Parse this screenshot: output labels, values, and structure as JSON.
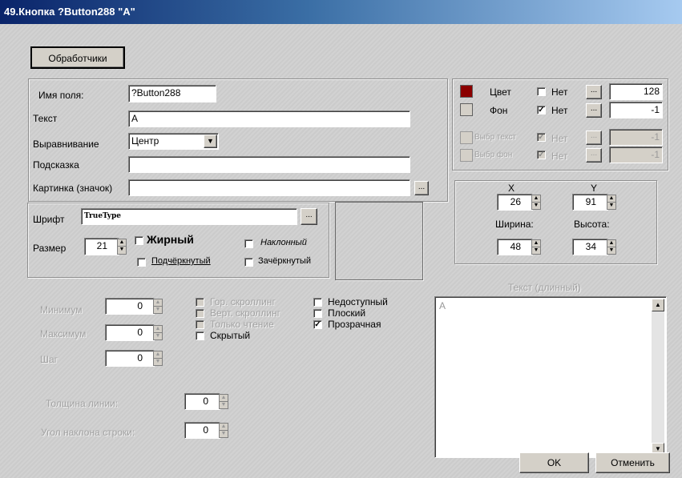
{
  "window": {
    "title": "49.Кнопка ?Button288 \"A\""
  },
  "toolbar": {
    "handlers_label": "Обработчики"
  },
  "props": {
    "field_name_label": "Имя поля:",
    "field_name_value": "?Button288",
    "text_label": "Текст",
    "text_value": "A",
    "align_label": "Выравнивание",
    "align_value": "Центр",
    "hint_label": "Подсказка",
    "hint_value": "",
    "image_label": "Картинка (значок)",
    "image_value": "",
    "browse": "..."
  },
  "colors": {
    "color_label": "Цвет",
    "color_none_label": "Нет",
    "color_none_checked": false,
    "color_value": "128",
    "color_swatch": "#8b0000",
    "bg_label": "Фон",
    "bg_none_label": "Нет",
    "bg_none_checked": true,
    "bg_value": "-1",
    "sel_text_label": "Выбр текст",
    "sel_text_none_label": "Нет",
    "sel_text_value": "-1",
    "sel_bg_label": "Выбр фон",
    "sel_bg_none_label": "Нет",
    "sel_bg_value": "-1"
  },
  "position": {
    "x_label": "X",
    "x_value": "26",
    "y_label": "Y",
    "y_value": "91",
    "width_label": "Ширина:",
    "width_value": "48",
    "height_label": "Высота:",
    "height_value": "34"
  },
  "font": {
    "font_label": "Шрифт",
    "font_value": "TrueType",
    "size_label": "Размер",
    "size_value": "21",
    "bold_label": "Жирный",
    "italic_label": "Наклонный",
    "underline_label": "Подчёркнутый",
    "strike_label": "Зачёркнутый"
  },
  "range": {
    "min_label": "Минимум",
    "min_value": "0",
    "max_label": "Максимум",
    "max_value": "0",
    "step_label": "Шаг",
    "step_value": "0"
  },
  "flags": {
    "hscroll_label": "Гор. скроллинг",
    "vscroll_label": "Верт. скроллинг",
    "readonly_label": "Только чтение",
    "hidden_label": "Скрытый",
    "disabled_label": "Недоступный",
    "flat_label": "Плоский",
    "transparent_label": "Прозрачная",
    "transparent_checked": true
  },
  "line": {
    "thickness_label": "Толщина линии:",
    "thickness_value": "0",
    "angle_label": "Угол наклона строки:",
    "angle_value": "0"
  },
  "longtext": {
    "label": "Текст (длинный)",
    "value": "A"
  },
  "footer": {
    "ok_label": "OK",
    "cancel_label": "Отменить"
  }
}
